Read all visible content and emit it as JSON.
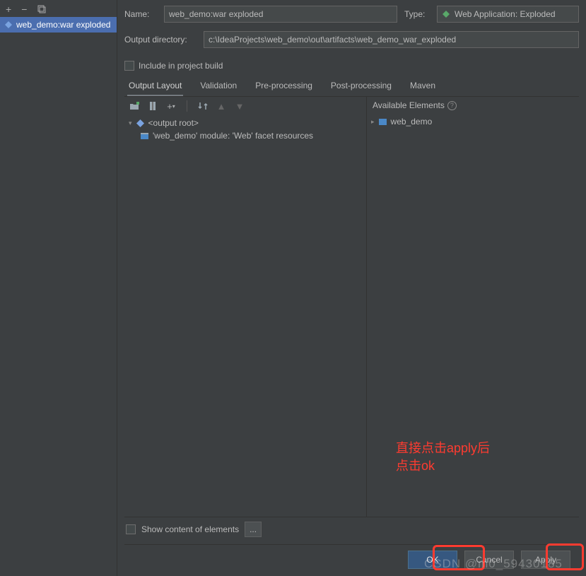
{
  "sidebar": {
    "selected": "web_demo:war exploded"
  },
  "form": {
    "name_label": "Name:",
    "name_value": "web_demo:war exploded",
    "type_label": "Type:",
    "type_value": "Web Application: Exploded",
    "outdir_label": "Output directory:",
    "outdir_value": "c:\\IdeaProjects\\web_demo\\out\\artifacts\\web_demo_war_exploded",
    "include_build": "Include in project build"
  },
  "tabs": {
    "items": [
      "Output Layout",
      "Validation",
      "Pre-processing",
      "Post-processing",
      "Maven"
    ],
    "active": 0
  },
  "layout": {
    "available_label": "Available Elements",
    "output_root": "<output root>",
    "facet_row": "'web_demo' module: 'Web' facet resources",
    "available_item": "web_demo"
  },
  "bottom": {
    "show_content": "Show content of elements",
    "ellipsis": "..."
  },
  "buttons": {
    "ok": "OK",
    "cancel": "Cancel",
    "apply": "Apply"
  },
  "annotation": {
    "line1": "直接点击apply后",
    "line2": "点击ok"
  },
  "watermark": "CSDN @m0_59430185"
}
